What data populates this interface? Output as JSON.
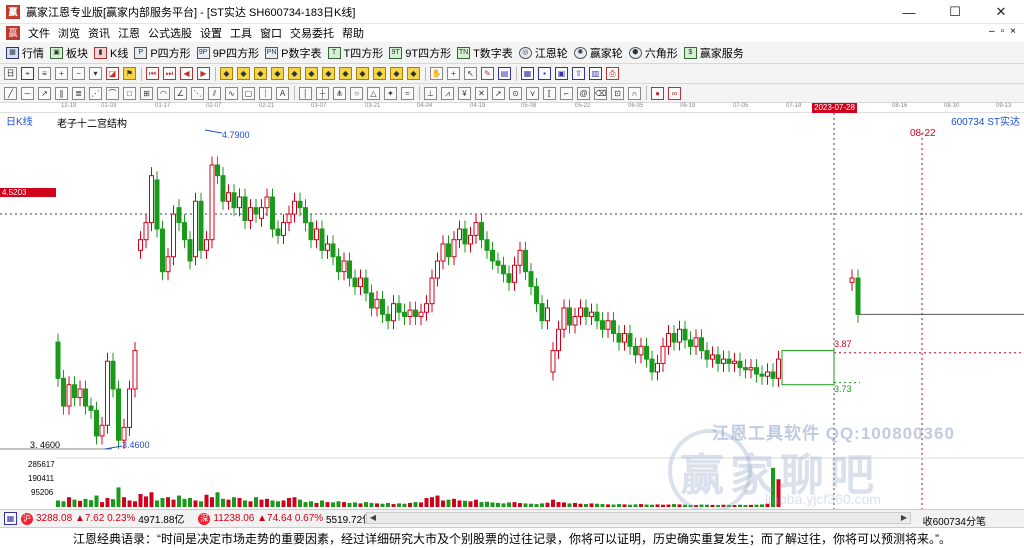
{
  "window": {
    "title": "赢家江恩专业版[赢家内部服务平台] - [ST实达  SH600734-183日K线]",
    "min": "—",
    "max": "☐",
    "close": "✕"
  },
  "menu": [
    "文件",
    "浏览",
    "资讯",
    "江恩",
    "公式选股",
    "设置",
    "工具",
    "窗口",
    "交易委托",
    "帮助"
  ],
  "toolbar1": [
    {
      "label": "行情",
      "icon": "grid-icon"
    },
    {
      "label": "板块",
      "icon": "blocks-icon"
    },
    {
      "label": "K线",
      "icon": "kline-icon"
    },
    {
      "label": "P四方形",
      "icon": "p-square-icon"
    },
    {
      "label": "9P四方形",
      "icon": "9p-square-icon"
    },
    {
      "label": "P数字表",
      "icon": "p-table-icon"
    },
    {
      "label": "T四方形",
      "icon": "t-square-icon"
    },
    {
      "label": "9T四方形",
      "icon": "9t-square-icon"
    },
    {
      "label": "T数字表",
      "icon": "t-table-icon"
    },
    {
      "label": "江恩轮",
      "icon": "gann-wheel-icon"
    },
    {
      "label": "赢家轮",
      "icon": "winner-wheel-icon"
    },
    {
      "label": "六角形",
      "icon": "hexagon-icon"
    },
    {
      "label": "赢家服务",
      "icon": "service-icon"
    }
  ],
  "ruler": {
    "dates": [
      "12-19",
      "01-03",
      "01-17",
      "02-07",
      "02-21",
      "03-07",
      "03-21",
      "04-04",
      "04-19",
      "05-08",
      "05-22",
      "06-05",
      "06-19",
      "07-05",
      "07-19",
      "08-16",
      "08-30",
      "09-13"
    ],
    "current": "2023-07-28"
  },
  "chart_header": {
    "period": "日K线",
    "indicator": "老子十二宫结构",
    "stock": "600734  ST实达",
    "future_date": "08-22"
  },
  "chart_labels": {
    "cursor_price": "4.5203",
    "high": "4.7900",
    "low": "3.4600",
    "low_axis": "3. 4600",
    "target_high": "3.87",
    "target_low": "3.73",
    "vol_axis": [
      "285617",
      "190411",
      "95206"
    ]
  },
  "chart_data": {
    "type": "candlestick",
    "title": "",
    "xlabel": "",
    "ylabel": "",
    "ylim": [
      3.4,
      4.9
    ],
    "points": [
      {
        "o": 3.92,
        "c": 3.75
      },
      {
        "o": 3.75,
        "c": 3.62
      },
      {
        "o": 3.62,
        "c": 3.72
      },
      {
        "o": 3.72,
        "c": 3.66
      },
      {
        "o": 3.66,
        "c": 3.7
      },
      {
        "o": 3.7,
        "c": 3.62
      },
      {
        "o": 3.62,
        "c": 3.6
      },
      {
        "o": 3.6,
        "c": 3.48
      },
      {
        "o": 3.48,
        "c": 3.53
      },
      {
        "o": 3.53,
        "c": 3.83
      },
      {
        "o": 3.83,
        "c": 3.7
      },
      {
        "o": 3.7,
        "c": 3.46
      },
      {
        "o": 3.46,
        "c": 3.52
      },
      {
        "o": 3.52,
        "c": 3.7
      },
      {
        "o": 3.7,
        "c": 3.88
      },
      {
        "o": 4.35,
        "c": 4.4
      },
      {
        "o": 4.4,
        "c": 4.48
      },
      {
        "o": 4.48,
        "c": 4.7
      },
      {
        "o": 4.68,
        "c": 4.45
      },
      {
        "o": 4.45,
        "c": 4.25
      },
      {
        "o": 4.25,
        "c": 4.32
      },
      {
        "o": 4.32,
        "c": 4.52
      },
      {
        "o": 4.55,
        "c": 4.48
      },
      {
        "o": 4.48,
        "c": 4.4
      },
      {
        "o": 4.4,
        "c": 4.3
      },
      {
        "o": 4.32,
        "c": 4.58
      },
      {
        "o": 4.58,
        "c": 4.35
      },
      {
        "o": 4.35,
        "c": 4.4
      },
      {
        "o": 4.4,
        "c": 4.75
      },
      {
        "o": 4.75,
        "c": 4.7
      },
      {
        "o": 4.7,
        "c": 4.58
      },
      {
        "o": 4.58,
        "c": 4.62
      },
      {
        "o": 4.62,
        "c": 4.55
      },
      {
        "o": 4.55,
        "c": 4.6
      },
      {
        "o": 4.6,
        "c": 4.49
      },
      {
        "o": 4.49,
        "c": 4.55
      },
      {
        "o": 4.55,
        "c": 4.52
      },
      {
        "o": 4.5,
        "c": 4.55
      },
      {
        "o": 4.55,
        "c": 4.6
      },
      {
        "o": 4.6,
        "c": 4.45
      },
      {
        "o": 4.45,
        "c": 4.42
      },
      {
        "o": 4.42,
        "c": 4.48
      },
      {
        "o": 4.48,
        "c": 4.52
      },
      {
        "o": 4.52,
        "c": 4.58
      },
      {
        "o": 4.58,
        "c": 4.55
      },
      {
        "o": 4.55,
        "c": 4.48
      },
      {
        "o": 4.48,
        "c": 4.4
      },
      {
        "o": 4.4,
        "c": 4.45
      },
      {
        "o": 4.45,
        "c": 4.35
      },
      {
        "o": 4.35,
        "c": 4.38
      },
      {
        "o": 4.38,
        "c": 4.32
      },
      {
        "o": 4.32,
        "c": 4.25
      },
      {
        "o": 4.25,
        "c": 4.3
      },
      {
        "o": 4.3,
        "c": 4.22
      },
      {
        "o": 4.22,
        "c": 4.18
      },
      {
        "o": 4.18,
        "c": 4.22
      },
      {
        "o": 4.22,
        "c": 4.15
      },
      {
        "o": 4.15,
        "c": 4.08
      },
      {
        "o": 4.08,
        "c": 4.12
      },
      {
        "o": 4.12,
        "c": 4.05
      },
      {
        "o": 4.05,
        "c": 4.02
      },
      {
        "o": 4.02,
        "c": 4.1
      },
      {
        "o": 4.1,
        "c": 4.06
      },
      {
        "o": 4.06,
        "c": 4.04
      },
      {
        "o": 4.04,
        "c": 4.07
      },
      {
        "o": 4.07,
        "c": 4.04
      },
      {
        "o": 4.04,
        "c": 4.06
      },
      {
        "o": 4.06,
        "c": 4.1
      },
      {
        "o": 4.1,
        "c": 4.22
      },
      {
        "o": 4.22,
        "c": 4.3
      },
      {
        "o": 4.3,
        "c": 4.38
      },
      {
        "o": 4.38,
        "c": 4.32
      },
      {
        "o": 4.32,
        "c": 4.4
      },
      {
        "o": 4.4,
        "c": 4.45
      },
      {
        "o": 4.45,
        "c": 4.38
      },
      {
        "o": 4.38,
        "c": 4.42
      },
      {
        "o": 4.42,
        "c": 4.48
      },
      {
        "o": 4.48,
        "c": 4.4
      },
      {
        "o": 4.4,
        "c": 4.35
      },
      {
        "o": 4.35,
        "c": 4.3
      },
      {
        "o": 4.3,
        "c": 4.28
      },
      {
        "o": 4.28,
        "c": 4.24
      },
      {
        "o": 4.24,
        "c": 4.2
      },
      {
        "o": 4.2,
        "c": 4.28
      },
      {
        "o": 4.28,
        "c": 4.35
      },
      {
        "o": 4.35,
        "c": 4.25
      },
      {
        "o": 4.25,
        "c": 4.18
      },
      {
        "o": 4.18,
        "c": 4.1
      },
      {
        "o": 4.1,
        "c": 4.02
      },
      {
        "o": 4.02,
        "c": 4.08
      },
      {
        "o": 3.78,
        "c": 3.88
      },
      {
        "o": 3.88,
        "c": 3.98
      },
      {
        "o": 3.98,
        "c": 4.08
      },
      {
        "o": 4.08,
        "c": 4.0
      },
      {
        "o": 4.0,
        "c": 4.04
      },
      {
        "o": 4.04,
        "c": 4.08
      },
      {
        "o": 4.08,
        "c": 4.04
      },
      {
        "o": 4.04,
        "c": 4.06
      },
      {
        "o": 4.06,
        "c": 4.02
      },
      {
        "o": 4.02,
        "c": 3.98
      },
      {
        "o": 3.98,
        "c": 4.02
      },
      {
        "o": 4.02,
        "c": 3.96
      },
      {
        "o": 3.96,
        "c": 3.92
      },
      {
        "o": 3.92,
        "c": 3.96
      },
      {
        "o": 3.96,
        "c": 3.9
      },
      {
        "o": 3.9,
        "c": 3.86
      },
      {
        "o": 3.86,
        "c": 3.9
      },
      {
        "o": 3.9,
        "c": 3.84
      },
      {
        "o": 3.84,
        "c": 3.78
      },
      {
        "o": 3.78,
        "c": 3.82
      },
      {
        "o": 3.82,
        "c": 3.9
      },
      {
        "o": 3.9,
        "c": 3.96
      },
      {
        "o": 3.96,
        "c": 3.92
      },
      {
        "o": 3.92,
        "c": 3.98
      },
      {
        "o": 3.98,
        "c": 3.93
      },
      {
        "o": 3.93,
        "c": 3.9
      },
      {
        "o": 3.9,
        "c": 3.94
      },
      {
        "o": 3.94,
        "c": 3.88
      },
      {
        "o": 3.88,
        "c": 3.84
      },
      {
        "o": 3.84,
        "c": 3.86
      },
      {
        "o": 3.86,
        "c": 3.82
      },
      {
        "o": 3.82,
        "c": 3.84
      },
      {
        "o": 3.84,
        "c": 3.82
      },
      {
        "o": 3.82,
        "c": 3.83
      },
      {
        "o": 3.83,
        "c": 3.8
      },
      {
        "o": 3.8,
        "c": 3.79
      },
      {
        "o": 3.79,
        "c": 3.8
      },
      {
        "o": 3.8,
        "c": 3.77
      },
      {
        "o": 3.77,
        "c": 3.76
      },
      {
        "o": 3.76,
        "c": 3.78
      },
      {
        "o": 3.78,
        "c": 3.75
      },
      {
        "o": 3.75,
        "c": 3.84
      },
      {
        "o": 4.2,
        "c": 4.22
      },
      {
        "o": 4.22,
        "c": 4.05
      }
    ],
    "volume": [
      40,
      35,
      60,
      45,
      38,
      50,
      42,
      70,
      30,
      55,
      48,
      120,
      60,
      40,
      35,
      80,
      65,
      90,
      40,
      55,
      60,
      45,
      70,
      50,
      55,
      40,
      35,
      75,
      60,
      90,
      50,
      45,
      60,
      55,
      40,
      35,
      60,
      45,
      50,
      40,
      35,
      40,
      55,
      60,
      45,
      30,
      35,
      25,
      40,
      30,
      28,
      35,
      30,
      25,
      28,
      22,
      30,
      25,
      22,
      20,
      25,
      18,
      22,
      20,
      25,
      30,
      28,
      55,
      60,
      70,
      40,
      45,
      50,
      40,
      38,
      35,
      45,
      30,
      32,
      28,
      25,
      22,
      28,
      30,
      24,
      22,
      20,
      18,
      22,
      26,
      45,
      30,
      28,
      22,
      25,
      20,
      18,
      22,
      20,
      18,
      16,
      15,
      18,
      16,
      14,
      16,
      18,
      15,
      14,
      16,
      14,
      15,
      18,
      16,
      14,
      13,
      12,
      15,
      14,
      13,
      12,
      14,
      13,
      12,
      14,
      12,
      13,
      14,
      16,
      20,
      240,
      170,
      0,
      0
    ],
    "vol_ylim": [
      0,
      300000
    ]
  },
  "watermark": {
    "line1": "江恩工具软件  QQ:100800360",
    "line2": "赢家聊吧",
    "line3": "liaoba.yjcf360.com"
  },
  "indexbar": {
    "sh": "3288.08",
    "sh_change": "▲7.62",
    "sh_pct": "0.23%",
    "sh_amount": "4971.88亿",
    "sz": "11238.06",
    "sz_change": "▲74.64",
    "sz_pct": "0.67%",
    "sz_amount": "5519.72亿",
    "close_info": "收600734分笔"
  },
  "quote": "江恩经典语录：“时间是决定市场走势的重要因素，经过详细研究大市及个别股票的过往记录，你将可以证明，历史确实重复发生；而了解过往，你将可以预测将来。”。",
  "colors": {
    "up": "#d0021b",
    "down": "#1a9a1a",
    "accent": "#1d4ed8"
  }
}
